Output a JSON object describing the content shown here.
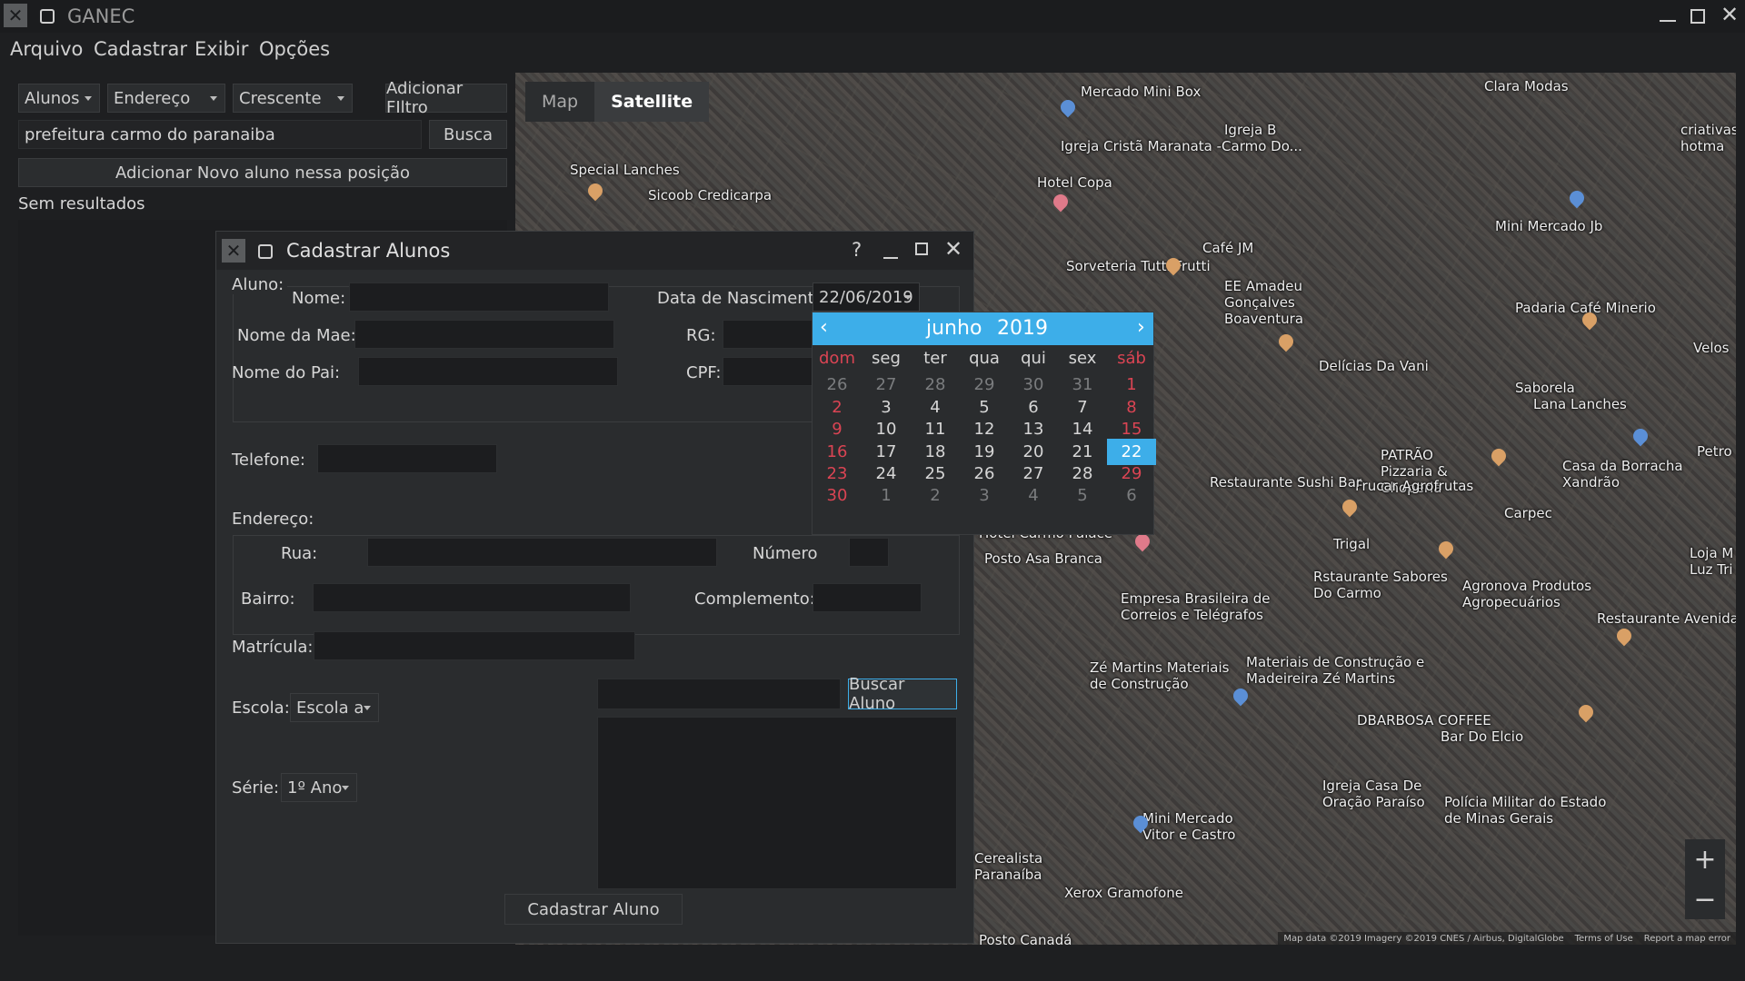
{
  "app": {
    "title": "GANEC",
    "menu": [
      "Arquivo",
      "Cadastrar",
      "Exibir",
      "Opções"
    ]
  },
  "left_panel": {
    "filter_field": "Alunos",
    "filter_by": "Endereço",
    "order": "Crescente",
    "add_filter_label": "Adicionar FIltro",
    "search_value": "prefeitura carmo do paranaiba",
    "search_button": "Busca",
    "add_student_button": "Adicionar Novo aluno nessa posição",
    "results_text": "Sem resultados"
  },
  "map": {
    "tabs": [
      "Map",
      "Satellite"
    ],
    "active_tab": "Satellite",
    "zoom_in": "+",
    "zoom_out": "−",
    "attribution": "Map data ©2019 Imagery ©2019 CNES / Airbus, DigitalGlobe",
    "terms": "Terms of Use",
    "report": "Report a map error",
    "labels": [
      "Mercado Mini Box",
      "Clara Modas",
      "Igreja Cristã Maranata -Carmo Do...",
      "Igreja B",
      "Special Lanches",
      "Sicoob Credicarpa",
      "Hotel Copa",
      "Café JM",
      "EE Amadeu Gonçalves Boaventura",
      "Mini Mercado Jb",
      "Sorveteria Tutti Frutti",
      "Padaria Café Minerio",
      "Delícias Da Vani",
      "Saborela",
      "Lana Lanches",
      "PATRÃO Pizzaria & Choperia",
      "Frucar Agrofrutas",
      "Casa da Borracha Xandrão",
      "Restaurante Sushi Bar",
      "Carpec",
      "Hotel Carmo Palace",
      "Trigal",
      "Posto Asa Branca",
      "Empresa Brasileira de Correios e Telégrafos",
      "Rstaurante Sabores Do Carmo",
      "Agronova Produtos Agropecuários",
      "Restaurante Avenida",
      "Zé Martins Materiais de Construção",
      "Materiais de Construção e Madeireira Zé Martins",
      "DBARBOSA COFFEE",
      "Bar Do Elcio",
      "Igreja Casa De Oração Paraíso",
      "Polícia Militar do Estado de Minas Gerais",
      "Mini Mercado Vitor e Castro",
      "Cerealista Paranaíba",
      "Xerox Gramofone",
      "Posto Canadá",
      "criativas hotma",
      "Loja M Luz Tri",
      "Velos",
      "Petro"
    ]
  },
  "dialog": {
    "title": "Cadastrar Alunos",
    "help": "?",
    "aluno_label": "Aluno:",
    "nome_label": "Nome:",
    "nome_value": "",
    "mae_label": "Nome da Mae:",
    "pai_label": "Nome do Pai:",
    "nasc_label": "Data de Nascimento",
    "nasc_value": "22/06/2019",
    "rg_label": "RG:",
    "cpf_label": "CPF:",
    "telefone_label": "Telefone:",
    "endereco_label": "Endereço:",
    "rua_label": "Rua:",
    "numero_label": "Número",
    "bairro_label": "Bairro:",
    "complemento_label": "Complemento:",
    "matricula_label": "Matrícula:",
    "escola_label": "Escola:",
    "escola_value": "Escola a",
    "serie_label": "Série:",
    "serie_value": "1º Ano",
    "buscar_button": "Buscar Aluno",
    "cadastrar_button": "Cadastrar Aluno"
  },
  "calendar": {
    "month": "junho",
    "year": "2019",
    "weekdays": [
      "dom",
      "seg",
      "ter",
      "qua",
      "qui",
      "sex",
      "sáb"
    ],
    "weeks": [
      [
        "26",
        "27",
        "28",
        "29",
        "30",
        "31",
        "1"
      ],
      [
        "2",
        "3",
        "4",
        "5",
        "6",
        "7",
        "8"
      ],
      [
        "9",
        "10",
        "11",
        "12",
        "13",
        "14",
        "15"
      ],
      [
        "16",
        "17",
        "18",
        "19",
        "20",
        "21",
        "22"
      ],
      [
        "23",
        "24",
        "25",
        "26",
        "27",
        "28",
        "29"
      ],
      [
        "30",
        "1",
        "2",
        "3",
        "4",
        "5",
        "6"
      ]
    ],
    "selected": "22",
    "colors": {
      "accent": "#3daee9",
      "weekend": "#da4453",
      "dim": "#7a7c7e"
    }
  }
}
